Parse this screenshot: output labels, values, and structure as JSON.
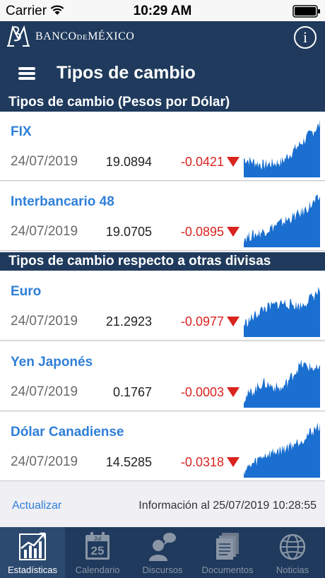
{
  "status_bar": {
    "carrier": "Carrier",
    "time": "10:29 AM"
  },
  "brand": {
    "name": "BANCO",
    "name_de": "DE",
    "name_country": "MÉXICO"
  },
  "header": {
    "title": "Tipos de cambio"
  },
  "sections": [
    {
      "title": "Tipos de cambio (Pesos por Dólar)"
    },
    {
      "title": "Tipos de cambio respecto a otras divisas"
    }
  ],
  "rates": [
    {
      "name": "FIX",
      "date": "24/07/2019",
      "value": "19.0894",
      "change": "-0.0421",
      "trend": "down"
    },
    {
      "name": "Interbancario 48",
      "date": "24/07/2019",
      "value": "19.0705",
      "change": "-0.0895",
      "trend": "down"
    },
    {
      "name": "Euro",
      "date": "24/07/2019",
      "value": "21.2923",
      "change": "-0.0977",
      "trend": "down"
    },
    {
      "name": "Yen Japonés",
      "date": "24/07/2019",
      "value": "0.1767",
      "change": "-0.0003",
      "trend": "down"
    },
    {
      "name": "Dólar Canadiense",
      "date": "24/07/2019",
      "value": "14.5285",
      "change": "-0.0318",
      "trend": "down"
    }
  ],
  "footer": {
    "refresh_label": "Actualizar",
    "updated_text": "Información al 25/07/2019 10:28:55"
  },
  "tabs": [
    {
      "label": "Estadísticas",
      "icon": "chart-icon",
      "active": true
    },
    {
      "label": "Calendario",
      "icon": "calendar-icon",
      "active": false,
      "calendar_month": "Jul",
      "calendar_day": "25"
    },
    {
      "label": "Discursos",
      "icon": "speaker-icon",
      "active": false
    },
    {
      "label": "Documentos",
      "icon": "documents-icon",
      "active": false
    },
    {
      "label": "Noticias",
      "icon": "globe-icon",
      "active": false
    }
  ],
  "colors": {
    "navy": "#1f3a5c",
    "link_blue": "#2f7fd8",
    "negative_red": "#d9241f",
    "chart_blue": "#1a6fd0"
  }
}
